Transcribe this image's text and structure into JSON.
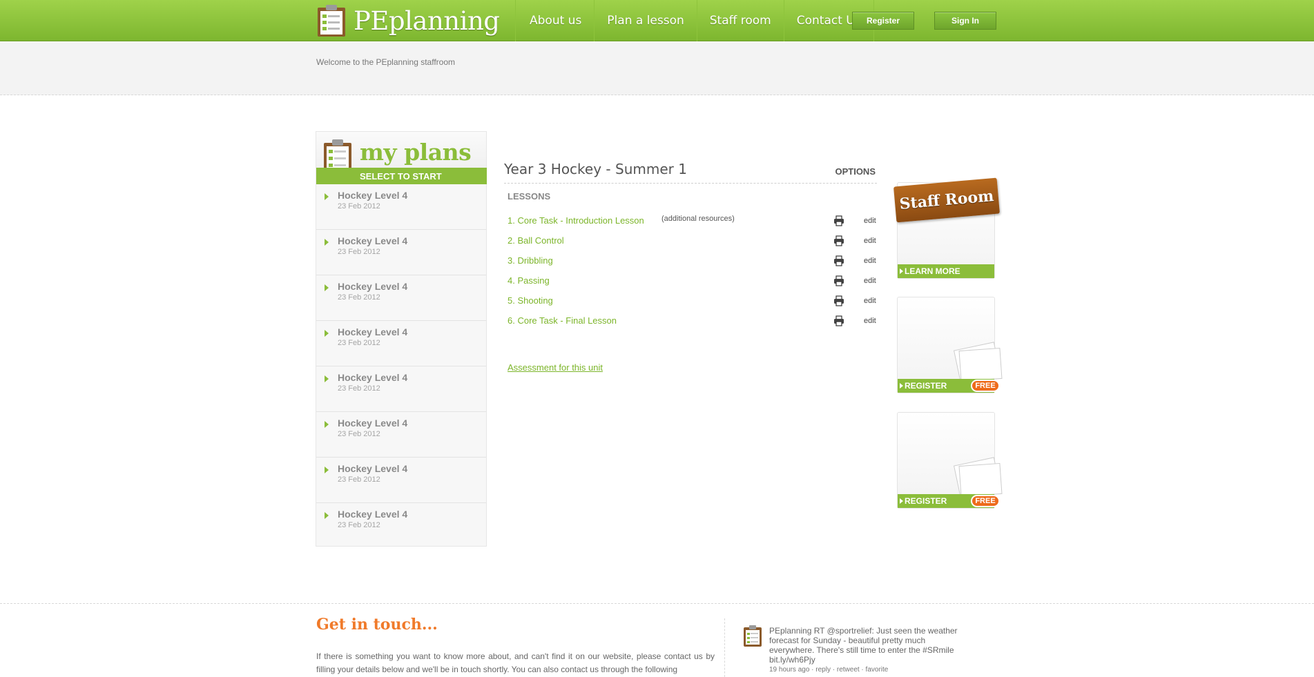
{
  "header": {
    "logo_text": "PEplanning",
    "nav": [
      "About us",
      "Plan a lesson",
      "Staff room",
      "Contact Us"
    ],
    "register_label": "Register",
    "signin_label": "Sign In"
  },
  "subbar": {
    "welcome": "Welcome to the PEplanning staffroom"
  },
  "plans": {
    "title": "my plans",
    "subtitle": "SELECT TO START",
    "items": [
      {
        "name": "Hockey Level 4",
        "date": "23 Feb 2012"
      },
      {
        "name": "Hockey Level 4",
        "date": "23 Feb 2012"
      },
      {
        "name": "Hockey Level 4",
        "date": "23 Feb 2012"
      },
      {
        "name": "Hockey Level 4",
        "date": "23 Feb 2012"
      },
      {
        "name": "Hockey Level 4",
        "date": "23 Feb 2012"
      },
      {
        "name": "Hockey Level 4",
        "date": "23 Feb 2012"
      },
      {
        "name": "Hockey Level 4",
        "date": "23 Feb 2012"
      },
      {
        "name": "Hockey Level 4",
        "date": "23 Feb 2012"
      }
    ]
  },
  "main": {
    "unit_title": "Year 3 Hockey - Summer 1",
    "options_label": "OPTIONS",
    "lessons_label": "LESSONS",
    "additional_resources": "(additional resources)",
    "edit_label": "edit",
    "lessons": [
      "1. Core Task - Introduction Lesson",
      "2. Ball Control",
      "3. Dribbling",
      "4. Passing",
      "5. Shooting",
      "6. Core Task - Final Lesson"
    ],
    "assessment_link": "Assessment for this unit"
  },
  "promos": {
    "staff_room_sign": "Staff Room",
    "learn_more": "LEARN MORE",
    "register": "REGISTER",
    "free_badge": "FREE"
  },
  "footer": {
    "get_in_touch_title": "Get in touch...",
    "get_in_touch_text": "If there is something you want to know more about, and can't find it on our website, please contact us by filling your details below and we'll be in touch shortly. You can also contact us through the following",
    "tweet_text": "PEplanning RT @sportrelief: Just seen the weather forecast for Sunday - beautiful pretty much everywhere. There's still time to enter the #SRmile bit.ly/wh6Pjy",
    "tweet_time": "19 hours ago",
    "tweet_reply": "reply",
    "tweet_retweet": "retweet",
    "tweet_favorite": "favorite"
  },
  "colors": {
    "brand_green": "#8bbd3a",
    "link_green": "#7cb52a",
    "accent_orange": "#f07a2a"
  }
}
